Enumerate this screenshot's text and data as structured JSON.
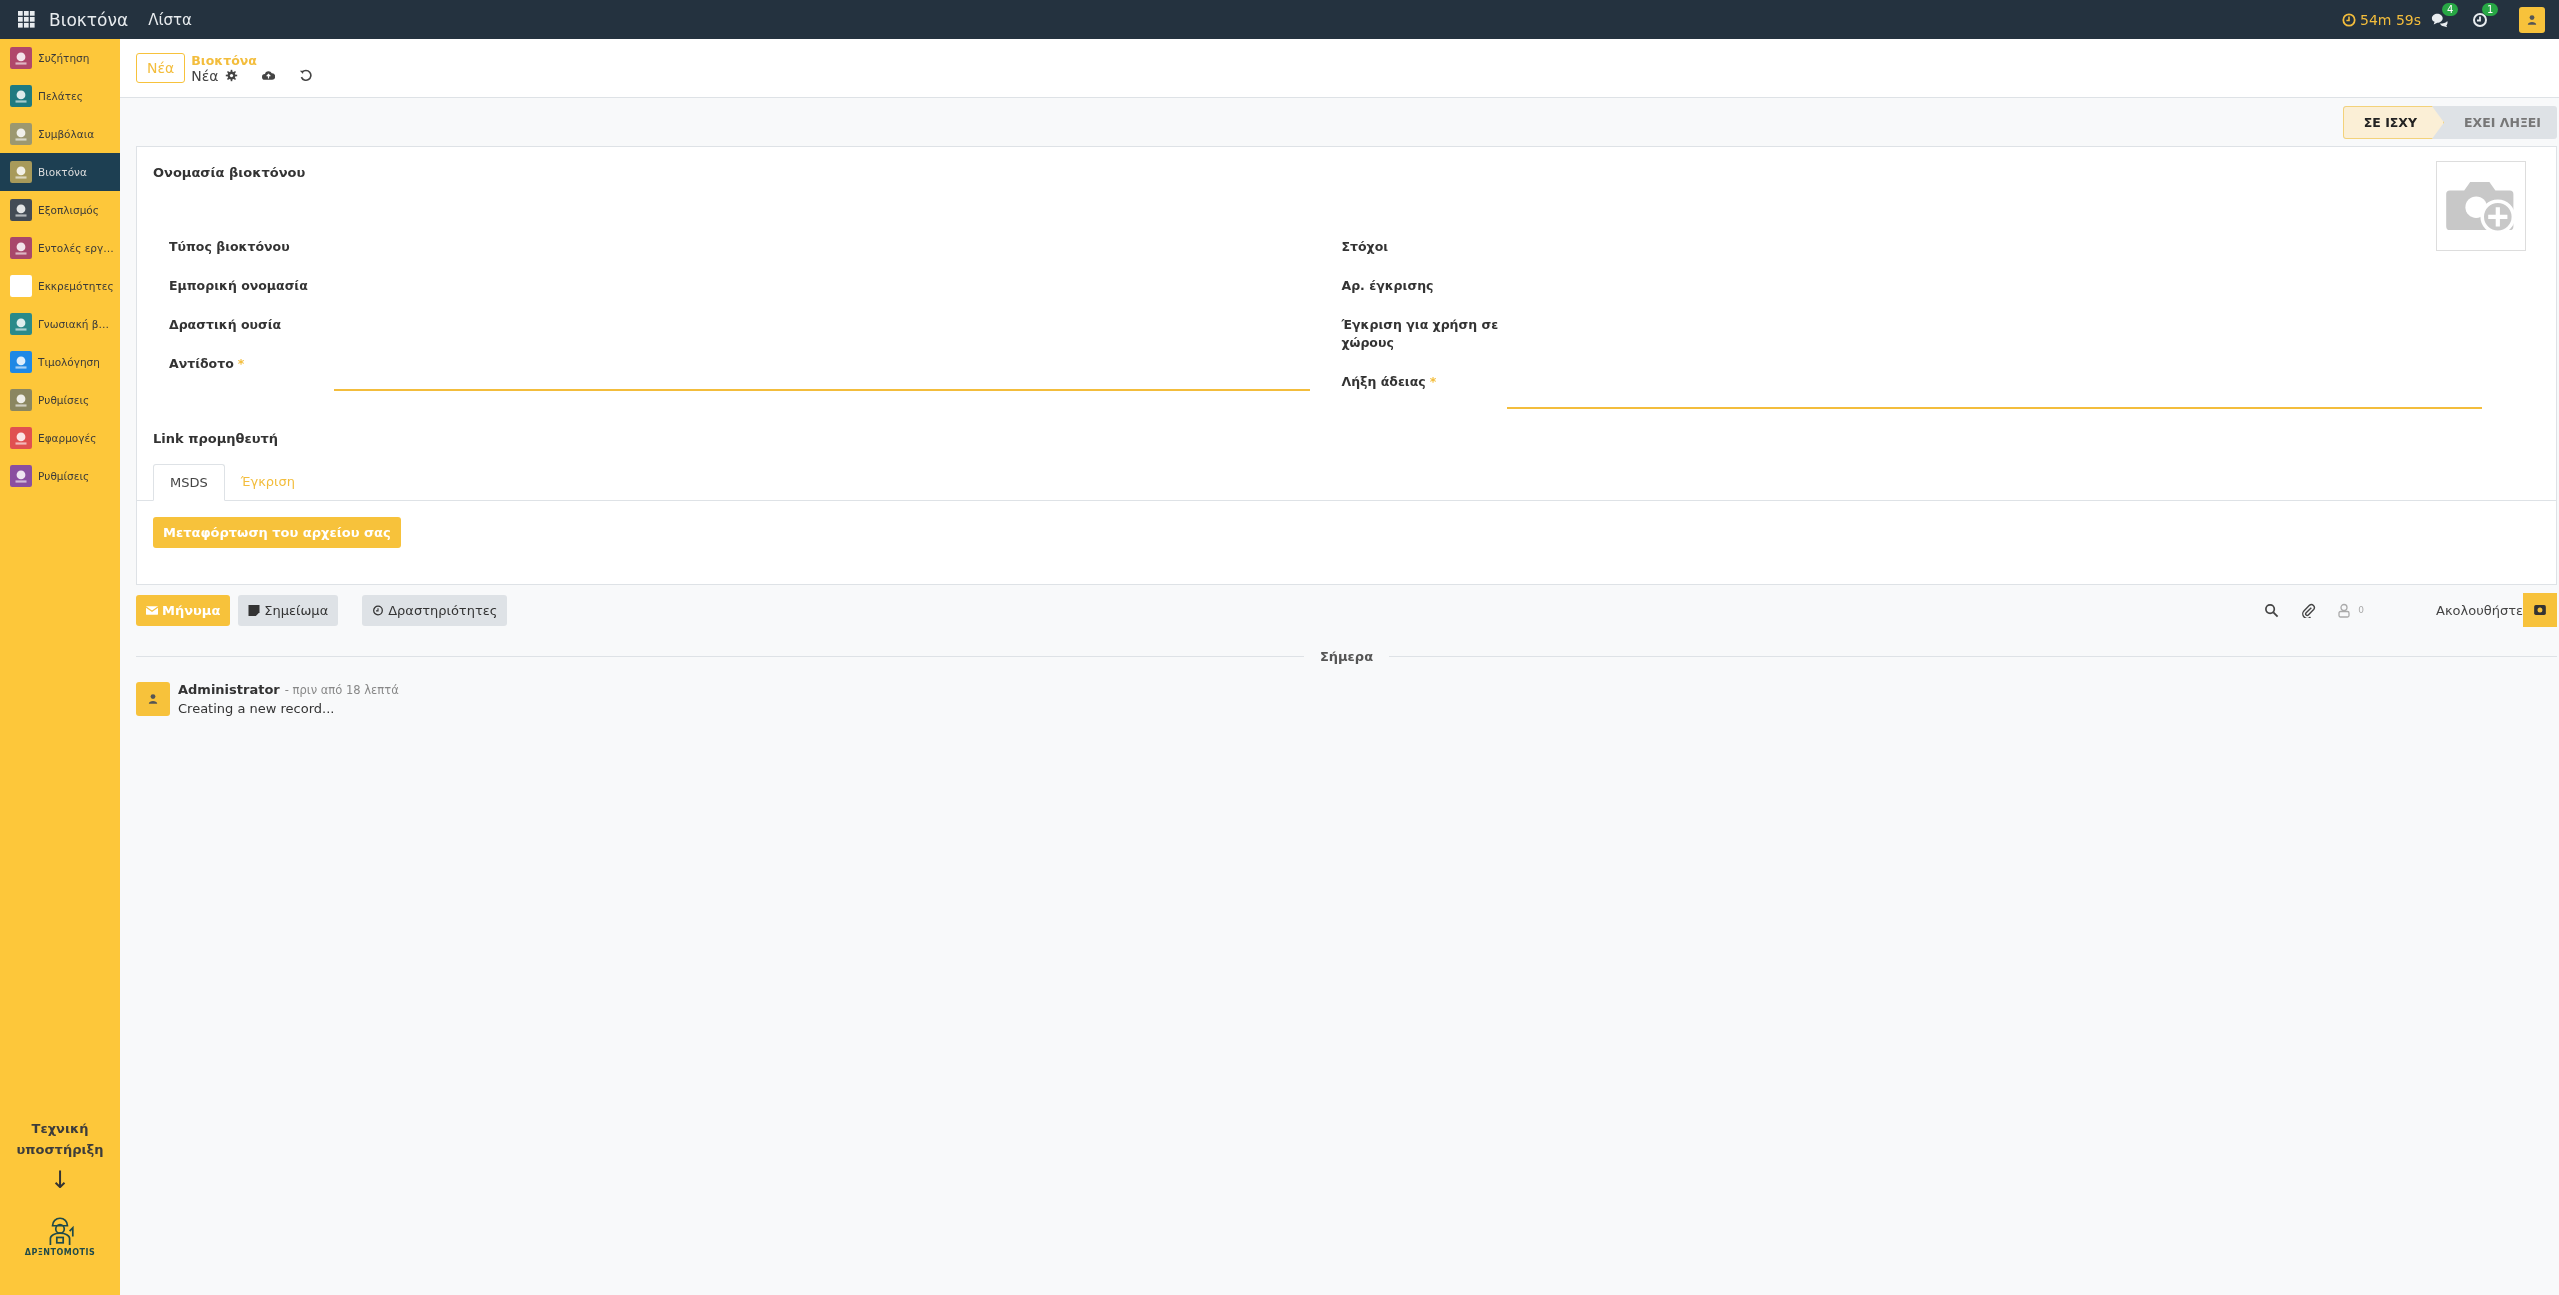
{
  "topbar": {
    "app_name": "Βιοκτόνα",
    "menu": [
      "Λίστα"
    ],
    "timer": "54m 59s",
    "messages_count": "4",
    "activities_count": "1"
  },
  "sidebar": {
    "items": [
      {
        "label": "Συζήτηση",
        "selected": false,
        "color": "#b0476a"
      },
      {
        "label": "Πελάτες",
        "selected": false,
        "color": "#1f7a80"
      },
      {
        "label": "Συμβόλαια",
        "selected": false,
        "color": "#9c9870"
      },
      {
        "label": "Βιοκτόνα",
        "selected": true,
        "color": "#a89a5a"
      },
      {
        "label": "Εξοπλισμός",
        "selected": false,
        "color": "#434b55"
      },
      {
        "label": "Εντολές εργ…",
        "selected": false,
        "color": "#a8476a"
      },
      {
        "label": "Εκκρεμότητες",
        "selected": false,
        "color": "#ffffff"
      },
      {
        "label": "Γνωσιακή β…",
        "selected": false,
        "color": "#2a8a8a"
      },
      {
        "label": "Τιμολόγηση",
        "selected": false,
        "color": "#1e88e5"
      },
      {
        "label": "Ρυθμίσεις",
        "selected": false,
        "color": "#8a8660"
      },
      {
        "label": "Εφαρμογές",
        "selected": false,
        "color": "#e05050"
      },
      {
        "label": "Ρυθμίσεις",
        "selected": false,
        "color": "#8a4fa0"
      }
    ],
    "support_text": "Τεχνική υποστήριξη",
    "arrow": "↓",
    "logo_text": "ΔΡΞΝΤΟΜΟTIS"
  },
  "control_panel": {
    "new_button": "Νέα",
    "breadcrumb": "Βιοκτόνα",
    "record": "Νέα"
  },
  "status_bar": [
    {
      "label": "ΣΕ ΙΣΧΥ",
      "selected": true
    },
    {
      "label": "ΕΧΕΙ ΛΗΞΕΙ",
      "selected": false
    }
  ],
  "form": {
    "title_label": "Ονομασία βιοκτόνου",
    "left_fields": [
      {
        "label": "Τύπος βιοκτόνου",
        "required": false
      },
      {
        "label": "Εμπορική ονομασία",
        "required": false
      },
      {
        "label": "Δραστική ουσία",
        "required": false
      },
      {
        "label": "Αντίδοτο",
        "required": true,
        "required_mark": "*"
      }
    ],
    "right_fields": [
      {
        "label": "Στόχοι",
        "required": false
      },
      {
        "label": "Αρ. έγκρισης",
        "required": false
      },
      {
        "label": "Έγκριση για χρήση σε χώρους",
        "required": false
      },
      {
        "label": "Λήξη άδειας",
        "required": true,
        "required_mark": "*"
      }
    ],
    "link_label": "Link προμηθευτή",
    "tabs": [
      {
        "label": "MSDS",
        "selected": true
      },
      {
        "label": "Έγκριση",
        "selected": false
      }
    ],
    "upload_button": "Μεταφόρτωση του αρχείου σας"
  },
  "chatter": {
    "buttons": [
      {
        "label": "Μήνυμα",
        "kind": "primary"
      },
      {
        "label": "Σημείωμα",
        "kind": "note"
      },
      {
        "label": "Δραστηριότητες",
        "kind": "activity"
      }
    ],
    "followers_count": "0",
    "follow_label": "Ακολουθήστε",
    "date_divider": "Σήμερα",
    "messages": [
      {
        "author": "Administrator",
        "time": "- πριν από 18 λεπτά",
        "body": "Creating a new record..."
      }
    ]
  }
}
